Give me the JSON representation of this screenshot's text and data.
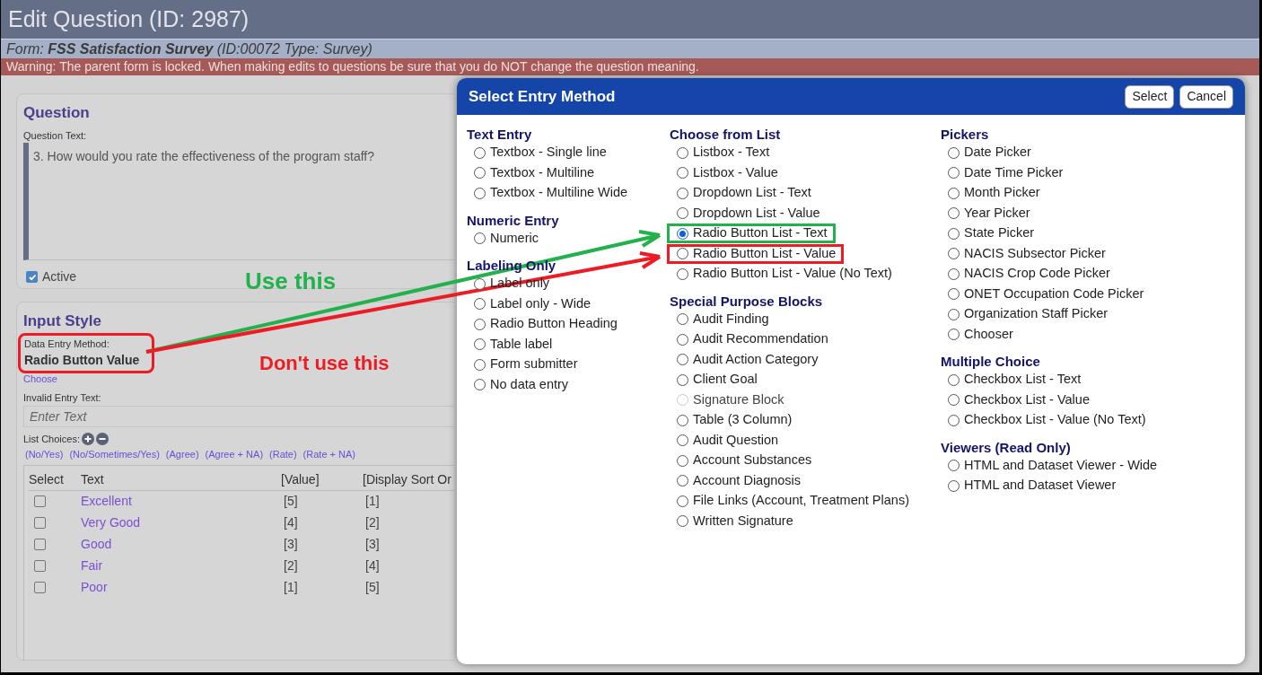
{
  "page": {
    "title": "Edit Question (ID: 2987)",
    "form_line": "Form: **FSS Satisfaction Survey** (ID:00072  Type: Survey)",
    "warning": "Warning: The parent form is locked. When making edits to questions be sure that you do NOT change the question meaning."
  },
  "question_panel": {
    "heading": "Question",
    "field_label": "Question Text:",
    "value": "3. How would you rate the effectiveness of the program staff?",
    "active": {
      "label": "Active",
      "checked": true
    }
  },
  "input_style": {
    "heading": "Input Style",
    "method_label": "Data Entry Method:",
    "method_value": "Radio Button Value",
    "choose_link": "Choose",
    "invalid_label": "Invalid Entry Text:",
    "invalid_placeholder": "Enter Text",
    "list_choices_label": "List Choices:",
    "presets": [
      "(No/Yes)",
      "(No/Sometimes/Yes)",
      "(Agree)",
      "(Agree + NA)",
      "(Rate)",
      "(Rate + NA)"
    ],
    "table": {
      "columns": [
        "Select",
        "Text",
        "[Value]",
        "[Display Sort Or"
      ],
      "rows": [
        {
          "checked": false,
          "text": "Excellent",
          "value": "[5]",
          "order": "[1]"
        },
        {
          "checked": false,
          "text": "Very Good",
          "value": "[4]",
          "order": "[2]"
        },
        {
          "checked": false,
          "text": "Good",
          "value": "[3]",
          "order": "[3]"
        },
        {
          "checked": false,
          "text": "Fair",
          "value": "[2]",
          "order": "[4]"
        },
        {
          "checked": false,
          "text": "Poor",
          "value": "[1]",
          "order": "[5]"
        }
      ]
    }
  },
  "modal": {
    "title": "Select Entry Method",
    "buttons": [
      "Select",
      "Cancel"
    ],
    "columns": [
      [
        {
          "heading": "Text Entry",
          "options": [
            {
              "label": "Textbox - Single line",
              "selected": false,
              "disabled": false
            },
            {
              "label": "Textbox - Multiline",
              "selected": false,
              "disabled": false
            },
            {
              "label": "Textbox - Multiline Wide",
              "selected": false,
              "disabled": false
            }
          ]
        },
        {
          "heading": "Numeric Entry",
          "options": [
            {
              "label": "Numeric",
              "selected": false,
              "disabled": false
            }
          ]
        },
        {
          "heading": "Labeling Only",
          "options": [
            {
              "label": "Label only",
              "selected": false,
              "disabled": false
            },
            {
              "label": "Label only - Wide",
              "selected": false,
              "disabled": false
            },
            {
              "label": "Radio Button Heading",
              "selected": false,
              "disabled": false
            },
            {
              "label": "Table label",
              "selected": false,
              "disabled": false
            },
            {
              "label": "Form submitter",
              "selected": false,
              "disabled": false
            },
            {
              "label": "No data entry",
              "selected": false,
              "disabled": false
            }
          ]
        }
      ],
      [
        {
          "heading": "Choose from List",
          "options": [
            {
              "label": "Listbox - Text",
              "selected": false,
              "disabled": false
            },
            {
              "label": "Listbox - Value",
              "selected": false,
              "disabled": false
            },
            {
              "label": "Dropdown List - Text",
              "selected": false,
              "disabled": false
            },
            {
              "label": "Dropdown List - Value",
              "selected": false,
              "disabled": false
            },
            {
              "label": "Radio Button List - Text",
              "selected": true,
              "disabled": false,
              "color": "#22b14c"
            },
            {
              "label": "Radio Button List - Value",
              "selected": false,
              "disabled": false,
              "color": "#ed1c24"
            },
            {
              "label": "Radio Button List - Value (No Text)",
              "selected": false,
              "disabled": false
            }
          ]
        },
        {
          "heading": "Special Purpose Blocks",
          "options": [
            {
              "label": "Audit Finding",
              "selected": false,
              "disabled": false
            },
            {
              "label": "Audit Recommendation",
              "selected": false,
              "disabled": false
            },
            {
              "label": "Audit Action Category",
              "selected": false,
              "disabled": false
            },
            {
              "label": "Client Goal",
              "selected": false,
              "disabled": false
            },
            {
              "label": "Signature Block",
              "selected": false,
              "disabled": true
            },
            {
              "label": "Table (3 Column)",
              "selected": false,
              "disabled": false
            },
            {
              "label": "Audit Question",
              "selected": false,
              "disabled": false
            },
            {
              "label": "Account Substances",
              "selected": false,
              "disabled": false
            },
            {
              "label": "Account Diagnosis",
              "selected": false,
              "disabled": false
            },
            {
              "label": "File Links (Account, Treatment Plans)",
              "selected": false,
              "disabled": false
            },
            {
              "label": "Written Signature",
              "selected": false,
              "disabled": false
            }
          ]
        }
      ],
      [
        {
          "heading": "Pickers",
          "options": [
            {
              "label": "Date Picker",
              "selected": false,
              "disabled": false
            },
            {
              "label": "Date Time Picker",
              "selected": false,
              "disabled": false
            },
            {
              "label": "Month Picker",
              "selected": false,
              "disabled": false
            },
            {
              "label": "Year Picker",
              "selected": false,
              "disabled": false
            },
            {
              "label": "State Picker",
              "selected": false,
              "disabled": false
            },
            {
              "label": "NACIS Subsector Picker",
              "selected": false,
              "disabled": false
            },
            {
              "label": "NACIS Crop Code Picker",
              "selected": false,
              "disabled": false
            },
            {
              "label": "ONET Occupation Code Picker",
              "selected": false,
              "disabled": false
            },
            {
              "label": "Organization Staff Picker",
              "selected": false,
              "disabled": false
            },
            {
              "label": "Chooser",
              "selected": false,
              "disabled": false
            }
          ]
        },
        {
          "heading": "Multiple Choice",
          "options": [
            {
              "label": "Checkbox List - Text",
              "selected": false,
              "disabled": false
            },
            {
              "label": "Checkbox List - Value",
              "selected": false,
              "disabled": false
            },
            {
              "label": "Checkbox List - Value (No Text)",
              "selected": false,
              "disabled": false
            }
          ]
        },
        {
          "heading": "Viewers (Read Only)",
          "options": [
            {
              "label": "HTML and Dataset Viewer - Wide",
              "selected": false,
              "disabled": false
            },
            {
              "label": "HTML and Dataset Viewer",
              "selected": false,
              "disabled": false
            }
          ]
        }
      ]
    ]
  },
  "annotations": [
    {
      "text": "Use this",
      "color": "#22b14c"
    },
    {
      "text": "Don't use this",
      "color": "#ed1c24"
    }
  ]
}
